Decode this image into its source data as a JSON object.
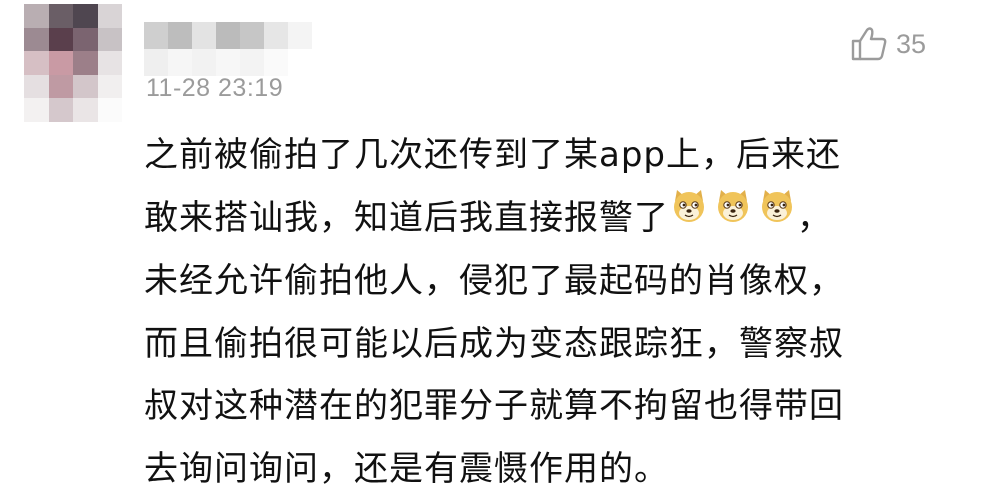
{
  "comment": {
    "timestamp": "11-28 23:19",
    "like_count": "35",
    "text_lines": [
      "之前被偷拍了几次还传到了某app上，后来还",
      "敢来搭讪我，知道后我直接报警了",
      "，",
      "未经允许偷拍他人，侵犯了最起码的肖像权，",
      "而且偷拍很可能以后成为变态跟踪狂，警察叔",
      "叔对这种潜在的犯罪分子就算不拘留也得带回",
      "去询问询问，还是有震慑作用的。"
    ],
    "emojis": [
      "doge-emoji",
      "doge-emoji",
      "doge-emoji"
    ]
  },
  "colors": {
    "meta_gray": "#9b9b9b",
    "text": "#111111"
  }
}
